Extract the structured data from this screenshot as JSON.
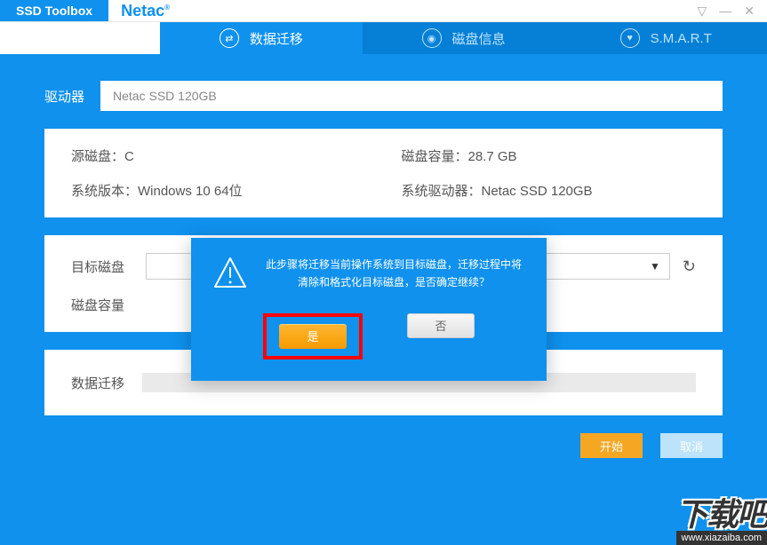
{
  "app": {
    "title": "SSD Toolbox",
    "brand": "Netac"
  },
  "window_controls": {
    "minimize": "▽",
    "restore": "—",
    "close": "✕"
  },
  "tabs": [
    {
      "label": "数据迁移",
      "icon": "migrate"
    },
    {
      "label": "磁盘信息",
      "icon": "disk"
    },
    {
      "label": "S.M.A.R.T",
      "icon": "smart"
    }
  ],
  "driver": {
    "label": "驱动器",
    "value": "Netac SSD 120GB"
  },
  "source_info": {
    "source_disk_label": "源磁盘：C",
    "capacity_label": "磁盘容量：28.7 GB",
    "os_label": "系统版本：Windows 10 64位",
    "driver_label": "系统驱动器：Netac SSD 120GB"
  },
  "target": {
    "disk_label": "目标磁盘",
    "capacity_label": "磁盘容量"
  },
  "migrate": {
    "label": "数据迁移"
  },
  "actions": {
    "start": "开始",
    "cancel": "取消"
  },
  "modal": {
    "message": "此步骤将迁移当前操作系统到目标磁盘，迁移过程中将清除和格式化目标磁盘，是否确定继续？",
    "yes": "是",
    "no": "否"
  },
  "watermark": {
    "text": "下载吧",
    "url": "www.xiazaiba.com"
  }
}
